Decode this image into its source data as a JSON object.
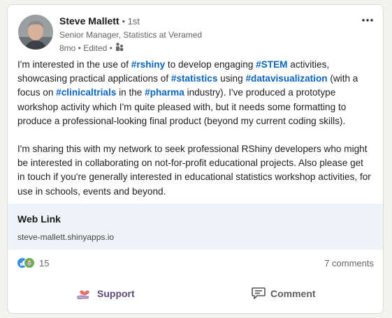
{
  "post": {
    "author": {
      "name": "Steve Mallett",
      "degree": "• 1st",
      "headline": "Senior Manager, Statistics at Veramed",
      "time": "8mo • Edited •"
    },
    "more_label": "•••",
    "paragraph1": [
      {
        "text": "I'm interested in the use of ",
        "tag": false
      },
      {
        "text": "#rshiny",
        "tag": true
      },
      {
        "text": " to develop engaging ",
        "tag": false
      },
      {
        "text": "#STEM",
        "tag": true
      },
      {
        "text": " activities, showcasing practical applications of ",
        "tag": false
      },
      {
        "text": "#statistics",
        "tag": true
      },
      {
        "text": " using ",
        "tag": false
      },
      {
        "text": "#datavisualization",
        "tag": true
      },
      {
        "text": " (with a focus on ",
        "tag": false
      },
      {
        "text": "#clinicaltrials",
        "tag": true
      },
      {
        "text": " in the ",
        "tag": false
      },
      {
        "text": "#pharma",
        "tag": true
      },
      {
        "text": " industry). I've produced a prototype workshop activity which I'm quite pleased with, but it needs some formatting to produce a professional-looking final product (beyond my current coding skills).",
        "tag": false
      }
    ],
    "paragraph2": "I'm sharing this with my network to seek professional RShiny developers who might be interested in collaborating on not-for-profit educational projects. Also please get in touch if you're generally interested in educational statistics workshop activities, for use in schools, events and beyond.",
    "link": {
      "title": "Web Link",
      "url": "steve-mallett.shinyapps.io"
    },
    "social": {
      "reactions_count": "15",
      "comments": "7 comments"
    },
    "actions": {
      "support": "Support",
      "comment": "Comment"
    }
  }
}
